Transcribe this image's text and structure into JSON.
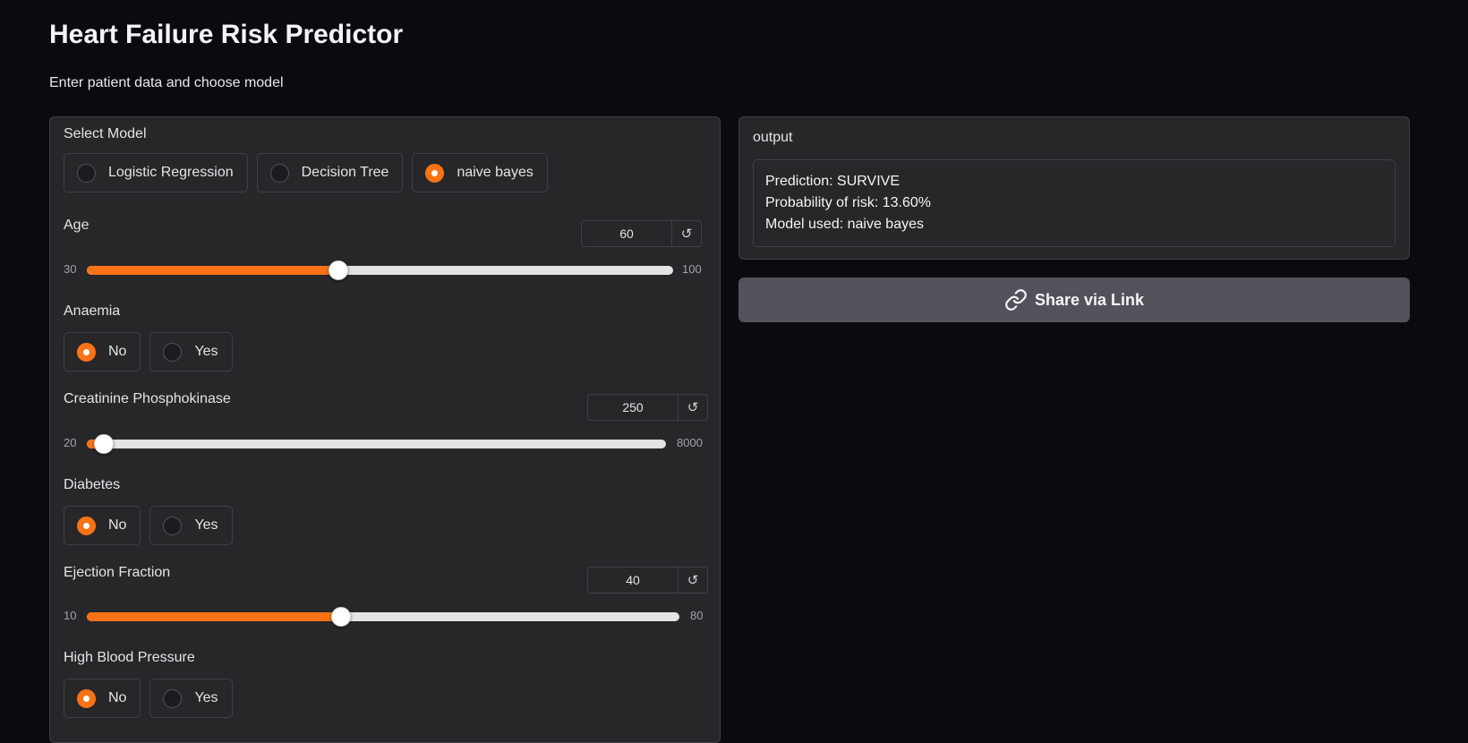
{
  "page": {
    "title": "Heart Failure Risk Predictor",
    "subtitle": "Enter patient data and choose model"
  },
  "inputs": {
    "model": {
      "label": "Select Model",
      "options": [
        "Logistic Regression",
        "Decision Tree",
        "naive bayes"
      ],
      "selected": "naive bayes"
    },
    "age": {
      "label": "Age",
      "value": "60",
      "min": "30",
      "max": "100"
    },
    "anaemia": {
      "label": "Anaemia",
      "options": [
        "No",
        "Yes"
      ],
      "selected": "No"
    },
    "creatinine": {
      "label": "Creatinine Phosphokinase",
      "value": "250",
      "min": "20",
      "max": "8000"
    },
    "diabetes": {
      "label": "Diabetes",
      "options": [
        "No",
        "Yes"
      ],
      "selected": "No"
    },
    "ejection_fraction": {
      "label": "Ejection Fraction",
      "value": "40",
      "min": "10",
      "max": "80"
    },
    "high_bp": {
      "label": "High Blood Pressure",
      "options": [
        "No",
        "Yes"
      ],
      "selected": "No"
    },
    "reset_symbol": "↺"
  },
  "output": {
    "label": "output",
    "lines": [
      "Prediction: SURVIVE",
      "Probability of risk: 13.60%",
      "Model used: naive bayes"
    ]
  },
  "share": {
    "label": "Share via Link",
    "icon": "link-icon"
  },
  "colors": {
    "accent": "#f97316",
    "background": "#0b0b0f",
    "panel": "#27272a",
    "border": "#3f3f46",
    "share_button": "#52525b"
  }
}
